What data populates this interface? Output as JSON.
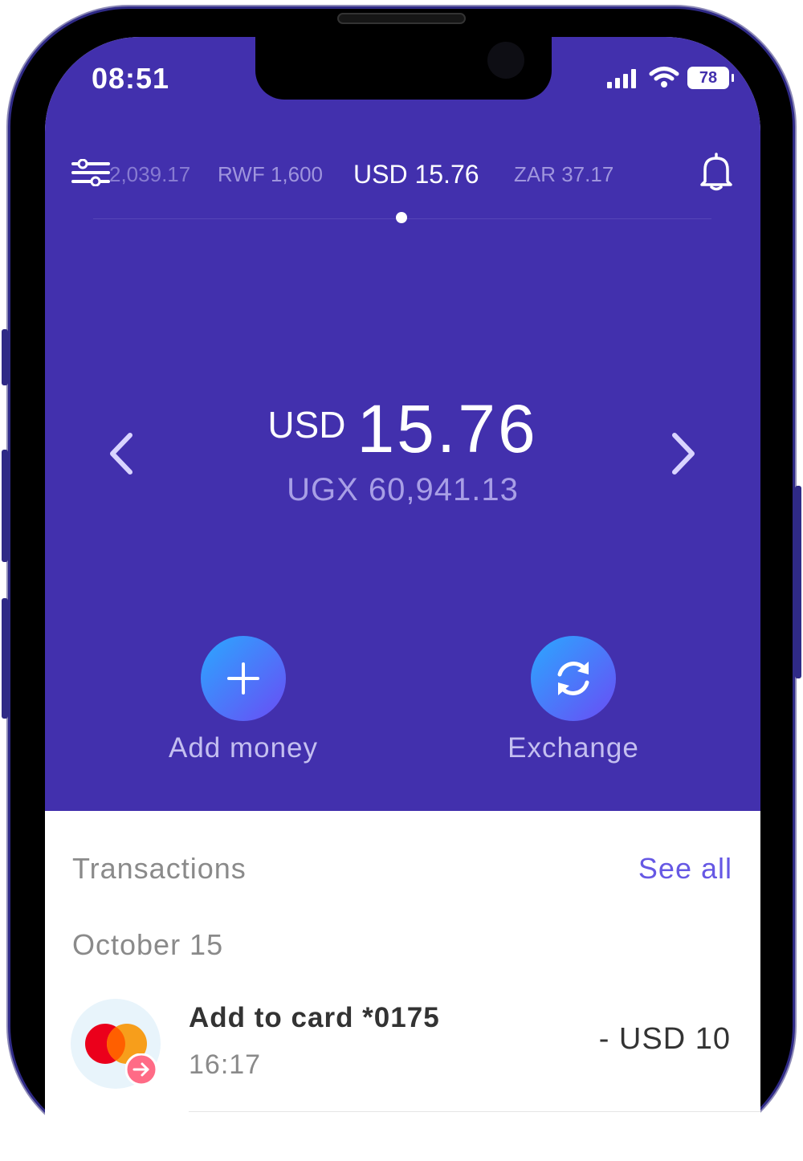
{
  "status_bar": {
    "time": "08:51",
    "battery": "78"
  },
  "accounts": {
    "tabs": [
      {
        "label": "2,039.17"
      },
      {
        "label": "RWF 1,600"
      },
      {
        "label": "USD 15.76"
      },
      {
        "label": "ZAR 37.17"
      }
    ],
    "active_index": 2
  },
  "balance": {
    "currency": "USD",
    "amount": "15.76",
    "converted": "UGX 60,941.13"
  },
  "actions": {
    "add_money": "Add money",
    "exchange": "Exchange"
  },
  "transactions": {
    "header": "Transactions",
    "see_all": "See all",
    "groups": [
      {
        "date": "October 15",
        "items": [
          {
            "title": "Add to card *0175",
            "time": "16:17",
            "amount": "- USD 10"
          }
        ]
      }
    ]
  },
  "colors": {
    "brand": "#4230ad",
    "link": "#6658e4",
    "action_gradient_start": "#2aa8ff",
    "action_gradient_end": "#6a4cf5"
  },
  "icons": [
    "filter-icon",
    "bell-icon",
    "chevron-left-icon",
    "chevron-right-icon",
    "plus-icon",
    "refresh-icon",
    "mastercard-icon",
    "arrow-right-icon"
  ]
}
